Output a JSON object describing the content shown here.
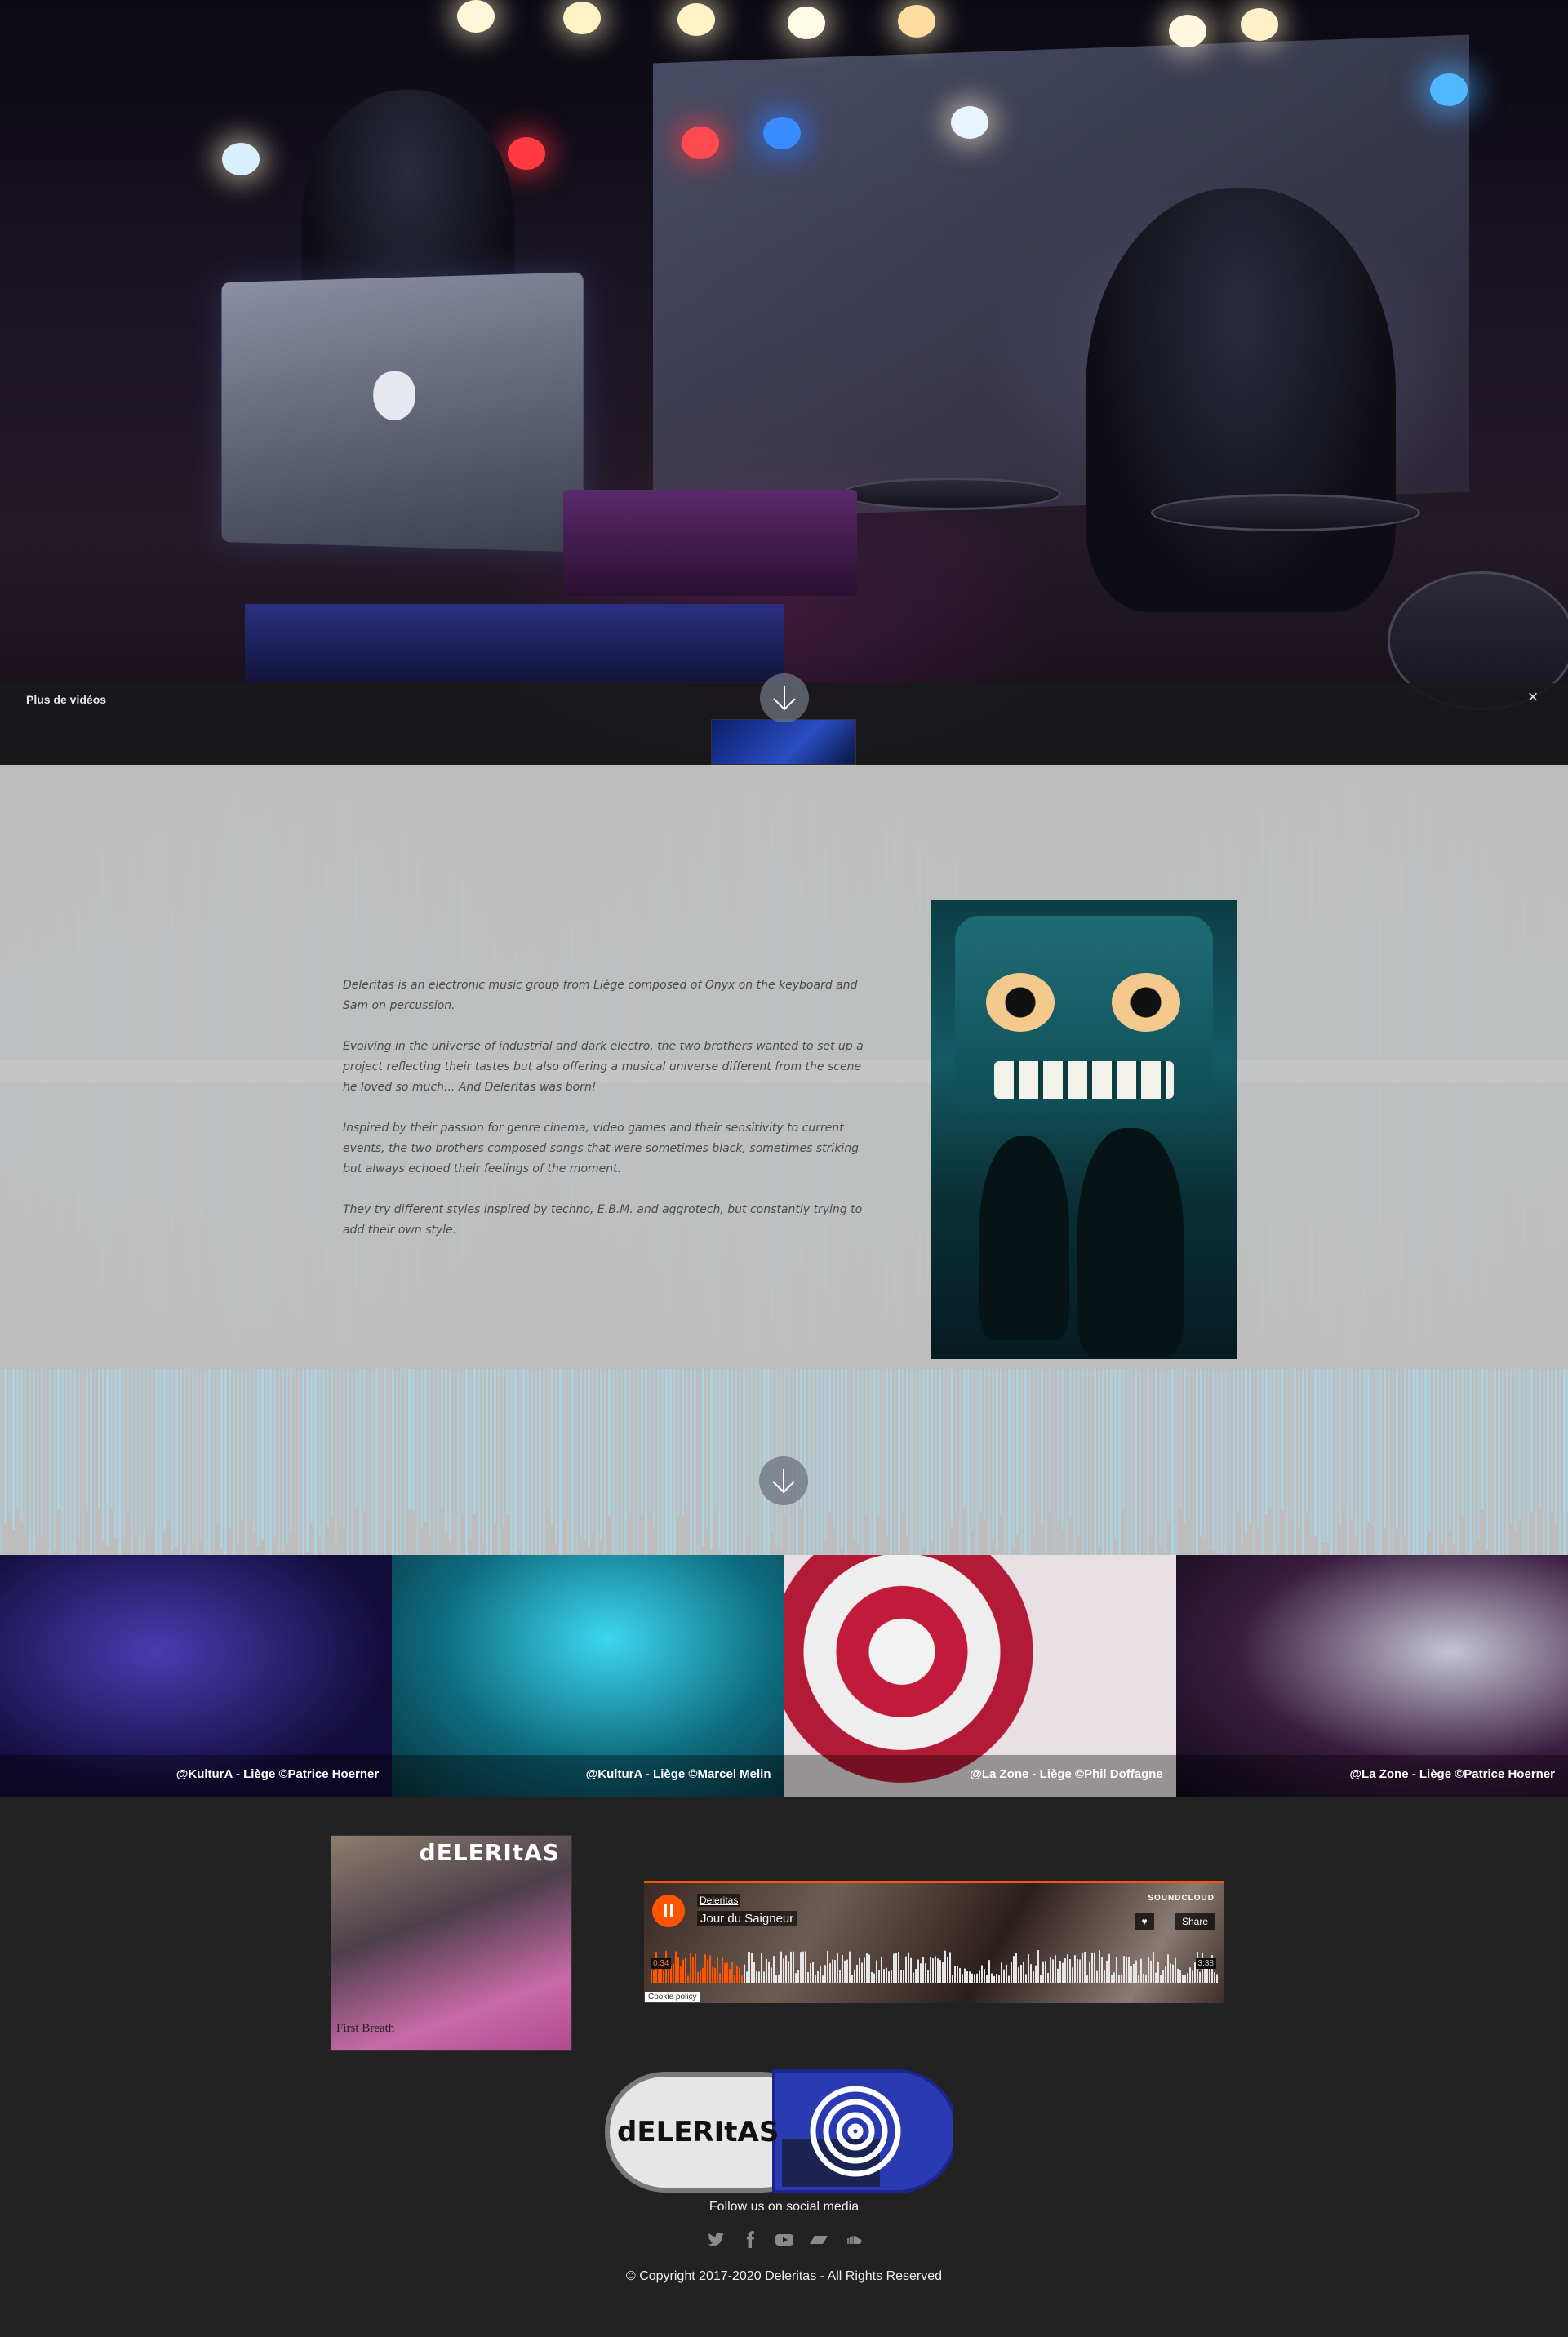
{
  "video": {
    "more_videos_label": "Plus de vidéos",
    "close_glyph": "×"
  },
  "about": {
    "paragraphs": [
      "Deleritas is an electronic music group from Liège composed of Onyx on the keyboard and Sam on percussion.",
      "Evolving in the universe of industrial and dark electro, the two brothers wanted to set up a project reflecting their tastes but also offering a musical universe different from the scene he loved so much... And Deleritas was born!",
      "Inspired by their passion for genre cinema, video games and their sensitivity to current events, the two brothers composed songs that were sometimes black, sometimes striking but always echoed their feelings of the moment.",
      "They try different styles inspired by techno, E.B.M. and aggrotech, but constantly trying to add their own style."
    ]
  },
  "gallery": [
    {
      "caption": "@KulturA - Liège ©Patrice Hoerner"
    },
    {
      "caption": "@KulturA - Liège ©Marcel Melin"
    },
    {
      "caption": "@La Zone - Liège ©Phil Doffagne"
    },
    {
      "caption": "@La Zone - Liège ©Patrice Hoerner"
    }
  ],
  "album": {
    "title": "dELERItAS",
    "subtitle": "First Breath"
  },
  "player": {
    "artist": "Deleritas",
    "track": "Jour du Saigneur",
    "brand": "SOUNDCLOUD",
    "like_glyph": "♥",
    "share_label": "Share",
    "elapsed": "0:34",
    "duration": "3:38",
    "cookie_label": "Cookie policy",
    "progress": 0.16,
    "accent": "#ff5500"
  },
  "logo": {
    "text": "dELERItAS"
  },
  "footer": {
    "follow_label": "Follow us on social media",
    "socials": [
      "twitter-icon",
      "facebook-icon",
      "youtube-icon",
      "bandcamp-icon",
      "soundcloud-icon"
    ],
    "copyright": "© Copyright 2017-2020 Deleritas - All Rights Reserved"
  },
  "colors": {
    "waveform": "#a9d9ea",
    "about_bg": "#bdbdbd",
    "footer_bg": "#222222"
  }
}
